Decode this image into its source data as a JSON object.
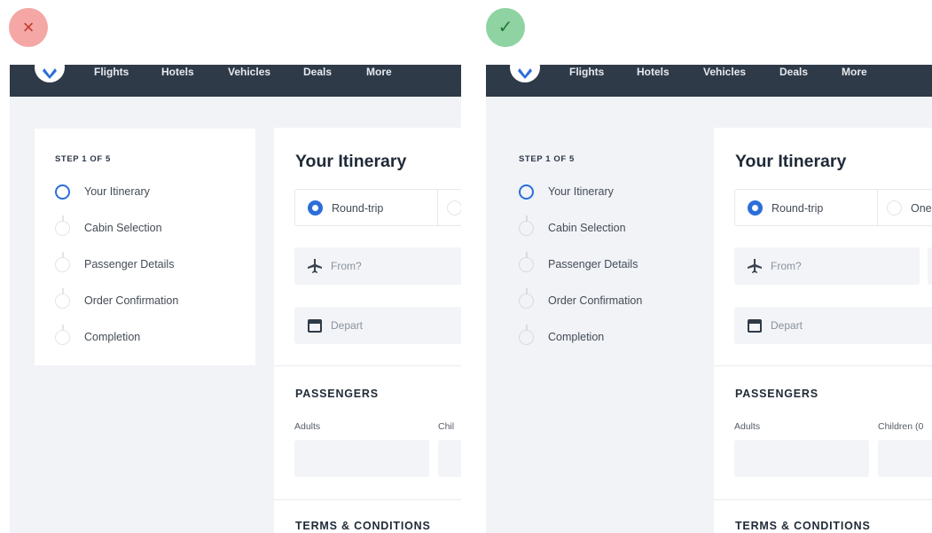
{
  "badges": {
    "bad": "×",
    "good": "✓"
  },
  "colors": {
    "accent": "#2c6ed8",
    "navbar": "#2f3a48",
    "bad": "#f4a7a4",
    "good": "#8fd3a2"
  },
  "nav": [
    "Flights",
    "Hotels",
    "Vehicles",
    "Deals",
    "More"
  ],
  "stepper": {
    "title": "STEP 1 OF 5",
    "steps": [
      "Your Itinerary",
      "Cabin Selection",
      "Passenger Details",
      "Order Confirmation",
      "Completion"
    ]
  },
  "bad": {
    "itinerary_title": "Your Itinerary",
    "trip_round": "Round-trip",
    "from_placeholder": "From?",
    "depart_placeholder": "Depart",
    "passengers_title": "PASSENGERS",
    "adults_label": "Adults",
    "children_label": "Chil",
    "terms_title": "TERMS & CONDITIONS"
  },
  "good": {
    "itinerary_title": "Your Itinerary",
    "trip_round": "Round-trip",
    "trip_one": "One",
    "from_placeholder": "From?",
    "depart_placeholder": "Depart",
    "passengers_title": "PASSENGERS",
    "adults_label": "Adults",
    "children_label": "Children (0",
    "terms_title": "TERMS & CONDITIONS"
  }
}
